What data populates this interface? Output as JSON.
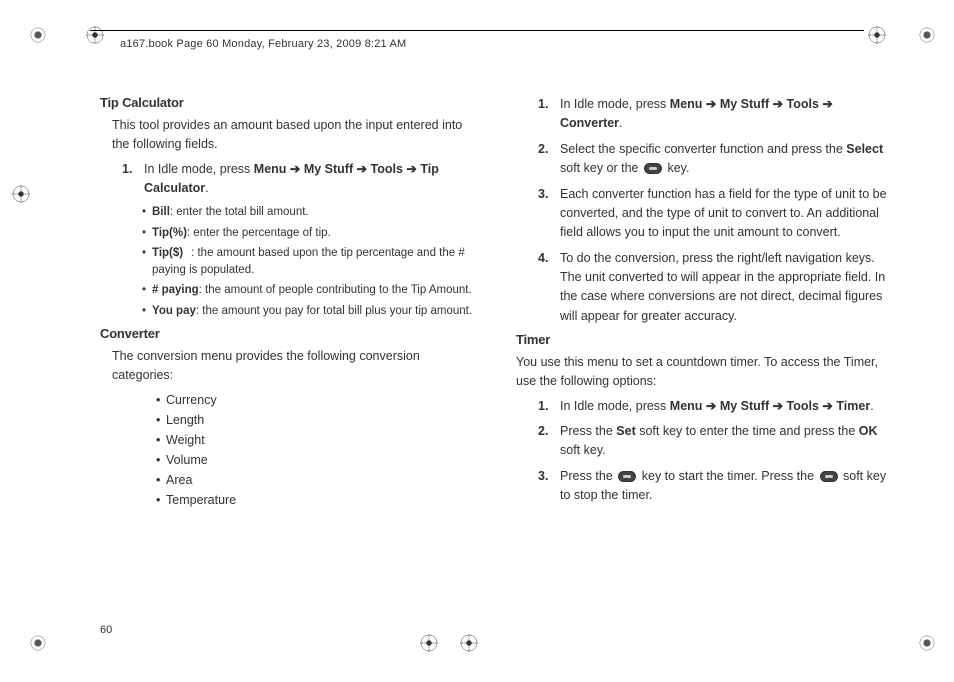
{
  "header": "a167.book  Page 60  Monday, February 23, 2009  8:21 AM",
  "page_number": "60",
  "tip_calc": {
    "title": "Tip Calculator",
    "intro": "This tool provides an amount based upon the input entered into the following fields.",
    "step1_pre": "In Idle mode, press ",
    "nav": "Menu ➔ My Stuff ➔ Tools ➔ Tip Calculator",
    "fields": [
      {
        "label": "Bill",
        "desc": ": enter the total bill amount."
      },
      {
        "label": "Tip(%)",
        "desc": ": enter the percentage of tip."
      },
      {
        "label": "Tip($)",
        "desc": ": the amount based upon the tip percentage and the # paying is populated."
      },
      {
        "label": "# paying",
        "desc": ": the amount of people contributing to the Tip Amount."
      },
      {
        "label": "You pay",
        "desc": ": the amount you pay for total bill plus your tip amount."
      }
    ]
  },
  "converter": {
    "title": "Converter",
    "intro": "The conversion menu provides the following conversion categories:",
    "cats": [
      "Currency",
      "Length",
      "Weight",
      "Volume",
      "Area",
      "Temperature"
    ],
    "step1_pre": "In Idle mode, press ",
    "nav": "Menu ➔ My Stuff ➔ Tools ➔ Converter",
    "step2a": "Select the specific converter function and press the ",
    "step2b": "Select",
    "step2c": " soft key or the ",
    "step2d": " key.",
    "step3": "Each converter function has a field for the type of unit to be converted, and the type of unit to convert to. An additional field allows you to input the unit amount to convert.",
    "step4": "To do the conversion, press the right/left navigation keys. The unit converted to will appear in the appropriate field. In the case where conversions are not direct, decimal figures will appear for greater accuracy."
  },
  "timer": {
    "title": "Timer",
    "intro": "You use this menu to set a countdown timer. To access the Timer, use the following options:",
    "step1_pre": "In Idle mode, press ",
    "nav": "Menu ➔ My Stuff ➔ Tools ➔ Timer",
    "step2a": "Press the ",
    "step2b": "Set",
    "step2c": " soft key to enter the time and press the ",
    "step2d": "OK",
    "step2e": " soft key.",
    "step3a": "Press the ",
    "step3b": " key to start the timer. Press the ",
    "step3c": " soft key to stop the timer."
  },
  "nums": {
    "1": "1.",
    "2": "2.",
    "3": "3.",
    "4": "4."
  },
  "period": "."
}
